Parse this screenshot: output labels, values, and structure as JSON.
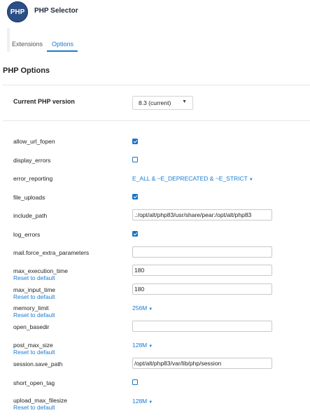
{
  "app": {
    "title": "PHP Selector",
    "logo_text": "PHP"
  },
  "tabs": [
    {
      "label": "Extensions",
      "active": false
    },
    {
      "label": "Options",
      "active": true
    }
  ],
  "section_title": "PHP Options",
  "current_version": {
    "label": "Current PHP version",
    "value": "8.3 (current)"
  },
  "reset_label": "Reset to default",
  "options": {
    "allow_url_fopen": {
      "label": "allow_url_fopen",
      "checked": true
    },
    "display_errors": {
      "label": "display_errors",
      "checked": false
    },
    "error_reporting": {
      "label": "error_reporting",
      "value": "E_ALL & ~E_DEPRECATED & ~E_STRICT"
    },
    "file_uploads": {
      "label": "file_uploads",
      "checked": true
    },
    "include_path": {
      "label": "include_path",
      "value": ".:/opt/alt/php83/usr/share/pear:/opt/alt/php83"
    },
    "log_errors": {
      "label": "log_errors",
      "checked": true
    },
    "mail_force_extra_parameters": {
      "label": "mail.force_extra_parameters",
      "value": ""
    },
    "max_execution_time": {
      "label": "max_execution_time",
      "value": "180"
    },
    "max_input_time": {
      "label": "max_input_time",
      "value": "180"
    },
    "memory_limit": {
      "label": "memory_limit",
      "value": "256M"
    },
    "open_basedir": {
      "label": "open_basedir",
      "value": ""
    },
    "post_max_size": {
      "label": "post_max_size",
      "value": "128M"
    },
    "session_save_path": {
      "label": "session.save_path",
      "value": "/opt/alt/php83/var/lib/php/session"
    },
    "short_open_tag": {
      "label": "short_open_tag",
      "checked": false
    },
    "upload_max_filesize": {
      "label": "upload_max_filesize",
      "value": "128M"
    }
  },
  "colors": {
    "accent": "#1a7bd1",
    "logo_bg": "#2b4f86"
  }
}
